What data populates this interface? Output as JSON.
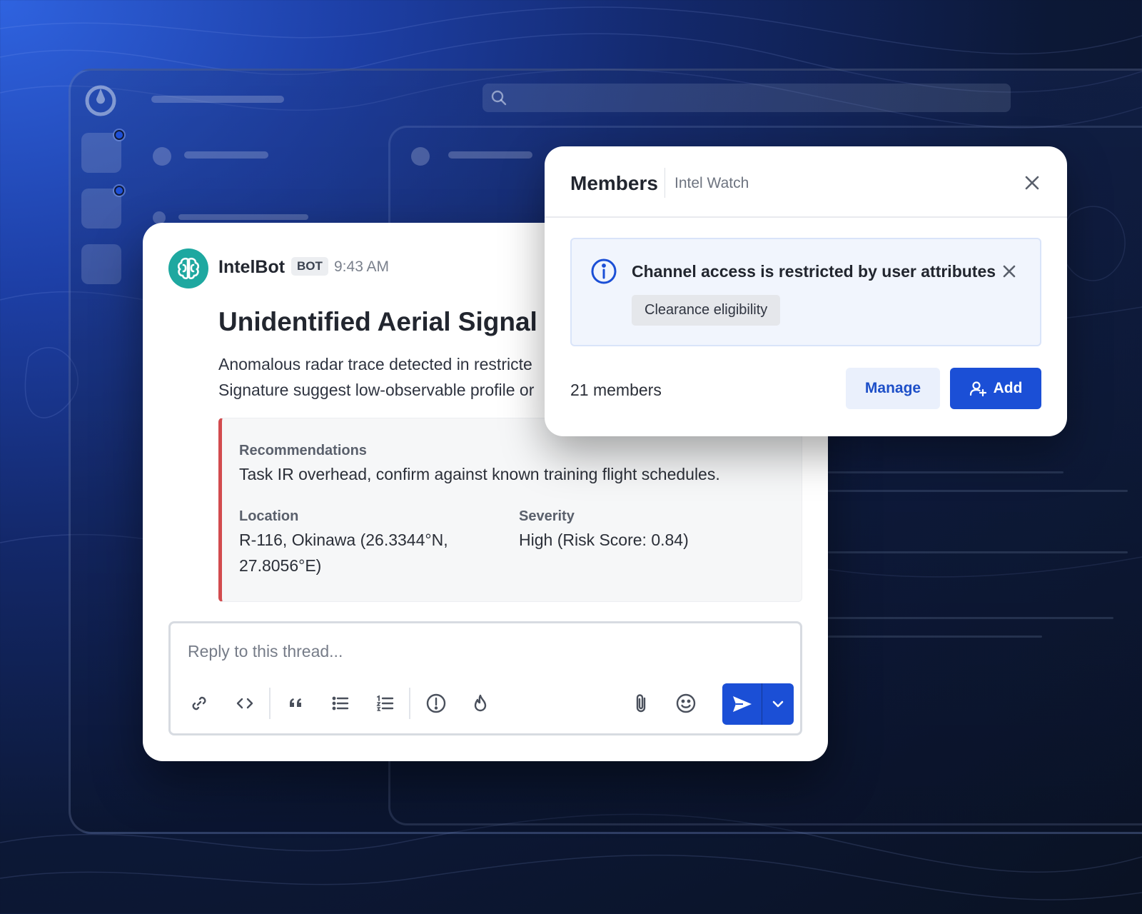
{
  "colors": {
    "accent": "#1b4fd6",
    "severity_bar": "#d24b4e",
    "avatar": "#1ea8a0",
    "background_dark": "#0a1223",
    "background_blue": "#2f63e0"
  },
  "message": {
    "author": "IntelBot",
    "tag": "BOT",
    "time": "9:43 AM",
    "avatar_icon": "brain-icon",
    "title": "Unidentified Aerial Signal i",
    "body_line1": "Anomalous radar trace detected in restricte",
    "body_line2": "Signature suggest low-observable profile or",
    "attachment": {
      "recommendations_label": "Recommendations",
      "recommendations_value": "Task IR overhead, confirm against known training flight schedules.",
      "location_label": "Location",
      "location_line1": "R-116, Okinawa (26.3344°N,",
      "location_line2": "27.8056°E)",
      "severity_label": "Severity",
      "severity_value": "High (Risk Score: 0.84)"
    }
  },
  "reply": {
    "placeholder": "Reply to this thread...",
    "tools": [
      "link-icon",
      "code-icon",
      "quote-icon",
      "bulleted-list-icon",
      "numbered-list-icon",
      "priority-icon",
      "burn-icon",
      "attachment-icon",
      "emoji-icon"
    ],
    "send_icon": "send-icon",
    "send_options_icon": "chevron-down-icon"
  },
  "members": {
    "title": "Members",
    "channel": "Intel Watch",
    "notice": "Channel access is restricted by user attributes",
    "chip": "Clearance eligibility",
    "count": "21 members",
    "manage_label": "Manage",
    "add_label": "Add"
  }
}
